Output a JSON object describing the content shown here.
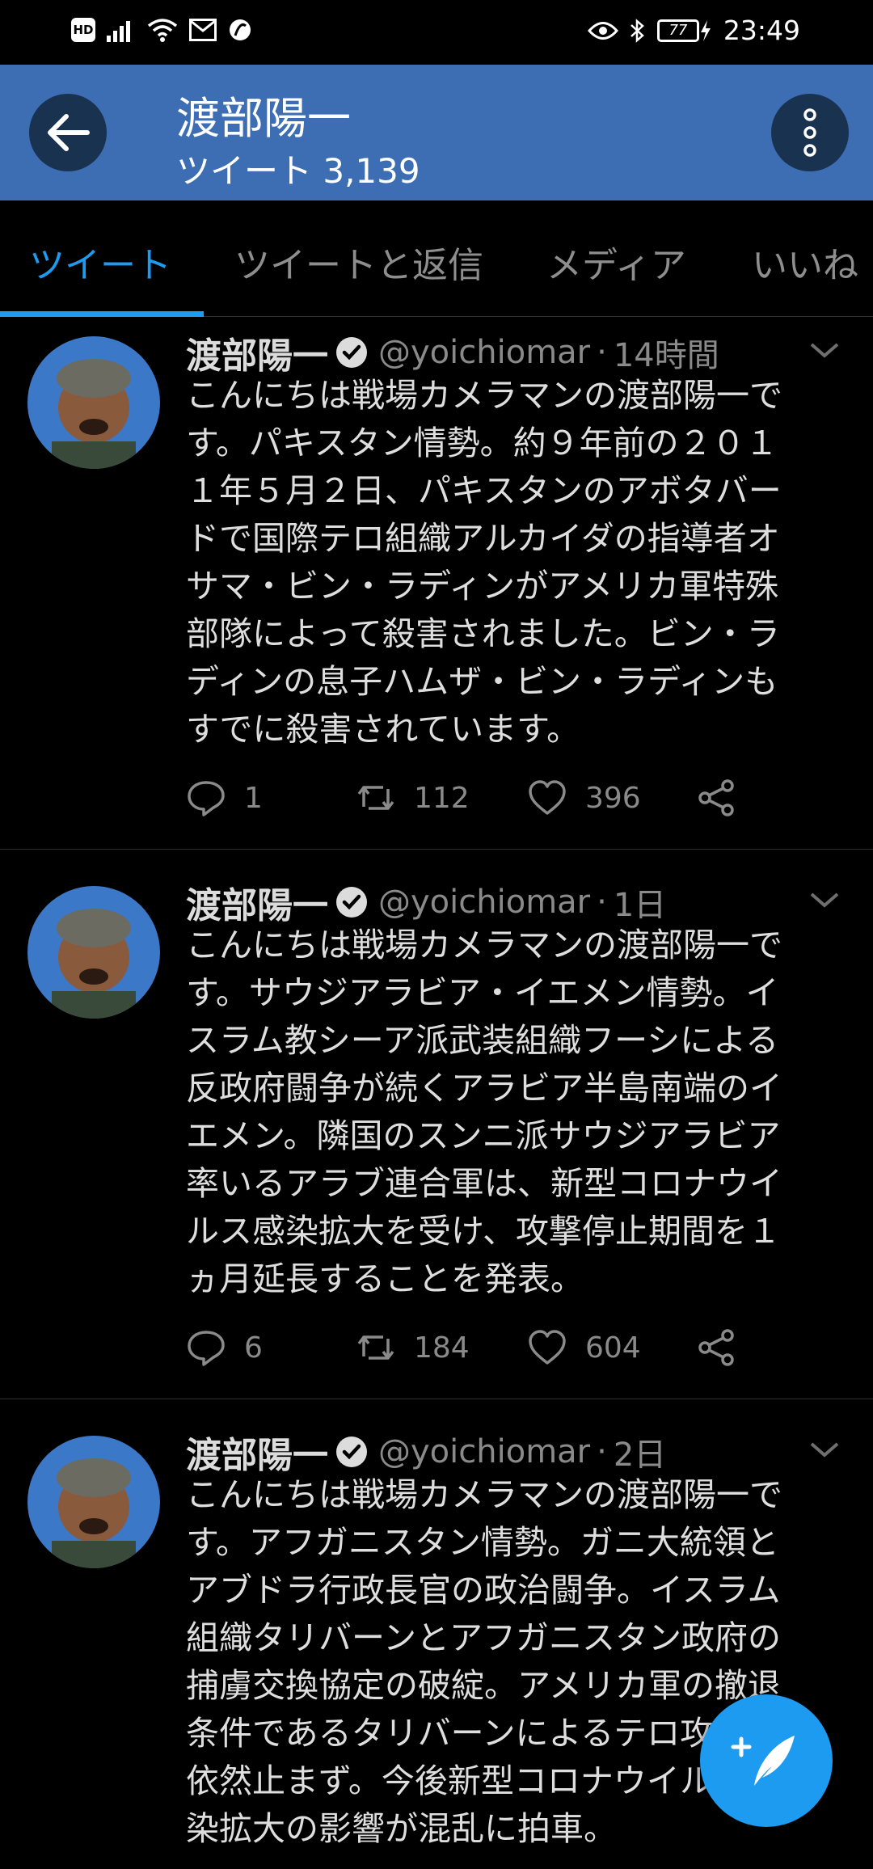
{
  "status_bar": {
    "time": "23:49",
    "battery": "77"
  },
  "header": {
    "title": "渡部陽一",
    "subtitle": "ツイート 3,139"
  },
  "tabs": [
    {
      "label": "ツイート",
      "active": true
    },
    {
      "label": "ツイートと返信",
      "active": false
    },
    {
      "label": "メディア",
      "active": false
    },
    {
      "label": "いいね",
      "active": false
    }
  ],
  "tweets": [
    {
      "name": "渡部陽一",
      "handle": "@yoichiomar",
      "dot": "·",
      "time": "14時間",
      "lines": [
        "こんにちは戦場カメラマンの渡部陽一で",
        "す。パキスタン情勢。約９年前の２０１",
        "１年５月２日、パキスタンのアボタバー",
        "ドで国際テロ組織アルカイダの指導者オ",
        "サマ・ビン・ラディンがアメリカ軍特殊",
        "部隊によって殺害されました。ビン・ラ",
        "ディンの息子ハムザ・ビン・ラディンも",
        "すでに殺害されています。"
      ],
      "replies": "1",
      "retweets": "112",
      "likes": "396"
    },
    {
      "name": "渡部陽一",
      "handle": "@yoichiomar",
      "dot": "·",
      "time": "1日",
      "lines": [
        "こんにちは戦場カメラマンの渡部陽一で",
        "す。サウジアラビア・イエメン情勢。イ",
        "スラム教シーア派武装組織フーシによる",
        "反政府闘争が続くアラビア半島南端のイ",
        "エメン。隣国のスンニ派サウジアラビア",
        "率いるアラブ連合軍は、新型コロナウイ",
        "ルス感染拡大を受け、攻撃停止期間を１",
        "ヵ月延長することを発表。"
      ],
      "replies": "6",
      "retweets": "184",
      "likes": "604"
    },
    {
      "name": "渡部陽一",
      "handle": "@yoichiomar",
      "dot": "·",
      "time": "2日",
      "lines": [
        "こんにちは戦場カメラマンの渡部陽一で",
        "す。アフガニスタン情勢。ガニ大統領と",
        "アブドラ行政長官の政治闘争。イスラム",
        "組織タリバーンとアフガニスタン政府の",
        "捕虜交換協定の破綻。アメリカ軍の撤退",
        "条件であるタリバーンによるテロ攻撃は",
        "依然止まず。今後新型コロナウイルス感",
        "染拡大の影響が混乱に拍車。"
      ]
    }
  ],
  "icons": {
    "back": "arrow-left-icon",
    "more": "more-vertical-icon",
    "verified": "verified-badge-icon",
    "reply": "reply-icon",
    "retweet": "retweet-icon",
    "like": "heart-icon",
    "share": "share-icon",
    "compose": "compose-tweet-icon"
  },
  "colors": {
    "header_bg": "#3d6eb3",
    "accent": "#1d9bf0",
    "background": "#000000"
  }
}
